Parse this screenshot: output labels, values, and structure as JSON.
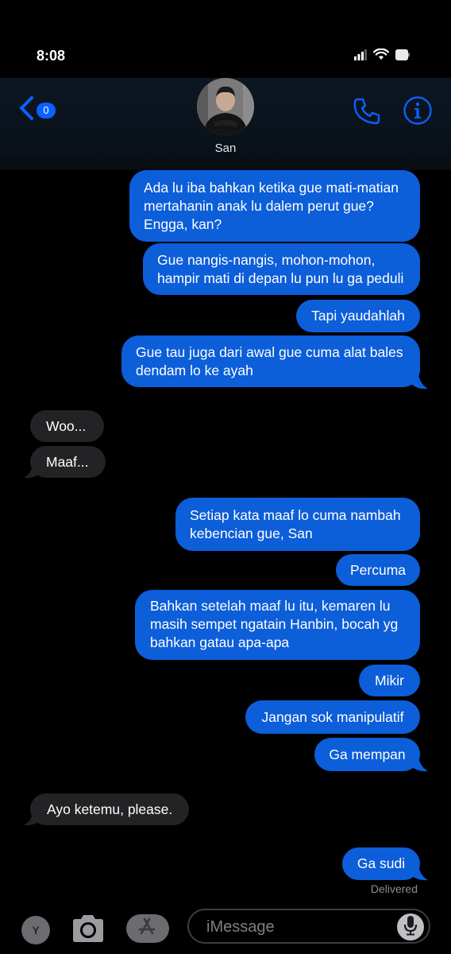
{
  "status_bar": {
    "time": "8:08"
  },
  "header": {
    "back_count": "0",
    "contact_name": "San"
  },
  "messages": [
    {
      "dir": "out",
      "text": "Ada lu iba bahkan ketika gue mati-matian mertahanin anak lu dalem perut gue? Engga, kan?"
    },
    {
      "dir": "out",
      "text": "Gue nangis-nangis, mohon-mohon, hampir mati di depan lu pun lu ga peduli"
    },
    {
      "dir": "out",
      "text": "Tapi yaudahlah"
    },
    {
      "dir": "out",
      "text": "Gue tau juga dari awal gue cuma alat bales dendam lo ke ayah"
    },
    {
      "dir": "in",
      "text": "Woo..."
    },
    {
      "dir": "in",
      "text": "Maaf..."
    },
    {
      "dir": "out",
      "text": "Setiap kata maaf lo cuma nambah kebencian gue, San"
    },
    {
      "dir": "out",
      "text": "Percuma"
    },
    {
      "dir": "out",
      "text": "Bahkan setelah maaf lu itu, kemaren lu masih sempet ngatain Hanbin, bocah yg bahkan gatau apa-apa"
    },
    {
      "dir": "out",
      "text": "Mikir"
    },
    {
      "dir": "out",
      "text": "Jangan sok manipulatif"
    },
    {
      "dir": "out",
      "text": "Ga mempan"
    },
    {
      "dir": "in",
      "text": "Ayo ketemu, please."
    },
    {
      "dir": "out",
      "text": "Ga sudi"
    }
  ],
  "delivered_label": "Delivered",
  "input_bar": {
    "app_letter": "Y",
    "placeholder": "iMessage"
  },
  "colors": {
    "outgoing_bubble": "#0c5ed9",
    "incoming_bubble": "#232326",
    "accent": "#0a60ff"
  }
}
